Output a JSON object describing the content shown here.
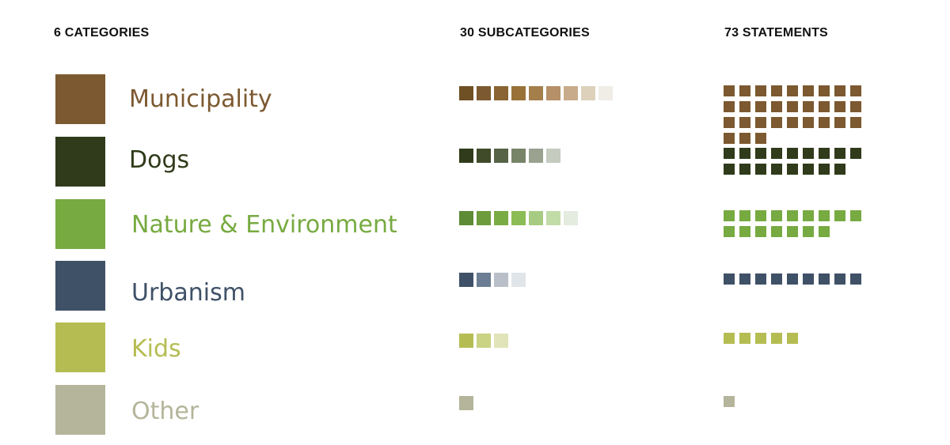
{
  "headers": {
    "categories": "6 CATEGORIES",
    "subcategories": "30 SUBCATEGORIES",
    "statements": "73 STATEMENTS"
  },
  "categories": [
    {
      "label": "Municipality",
      "color": "#7c5930",
      "subcategory_colors": [
        "#6f4f24",
        "#7c5930",
        "#8a6433",
        "#987139",
        "#a47f4c",
        "#b69068",
        "#c8ab8a",
        "#ddd1bc",
        "#f0ede6"
      ],
      "statements": 30
    },
    {
      "label": "Dogs",
      "color": "#2f3b1a",
      "subcategory_colors": [
        "#2f3b1a",
        "#3f4b29",
        "#566346",
        "#788468",
        "#9aa18f",
        "#c5cbbf"
      ],
      "statements": 17
    },
    {
      "label": "Nature & Environment",
      "color": "#77aa41",
      "subcategory_colors": [
        "#5d8b36",
        "#6c9c3b",
        "#7aac44",
        "#8cbc55",
        "#a7cb82",
        "#c2dca8",
        "#e4ece0"
      ],
      "statements": 16
    },
    {
      "label": "Urbanism",
      "color": "#3f5167",
      "subcategory_colors": [
        "#3f5167",
        "#6b7e93",
        "#b8bfc8",
        "#e0e5ea"
      ],
      "statements": 9
    },
    {
      "label": "Kids",
      "color": "#b5bd52",
      "subcategory_colors": [
        "#b5bd52",
        "#cad283",
        "#e1e4b8"
      ],
      "statements": 5
    },
    {
      "label": "Other",
      "color": "#b4b59a",
      "subcategory_colors": [
        "#b4b59a"
      ],
      "statements": 1
    }
  ]
}
